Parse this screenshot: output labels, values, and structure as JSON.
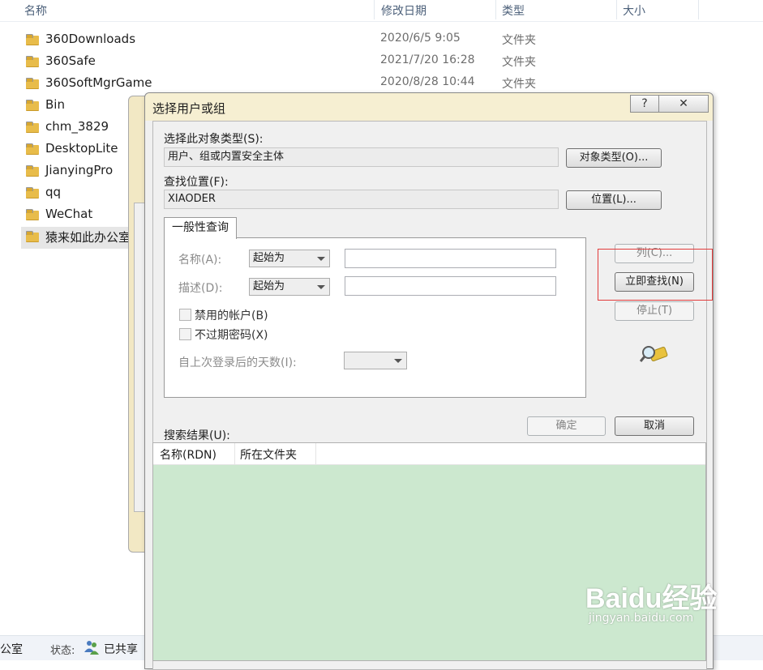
{
  "explorer": {
    "columns": {
      "name": "名称",
      "modified": "修改日期",
      "type": "类型",
      "size": "大小"
    },
    "files": [
      {
        "name": "360Downloads",
        "date": "2020/6/5 9:05",
        "type": "文件夹"
      },
      {
        "name": "360Safe",
        "date": "2021/7/20 16:28",
        "type": "文件夹"
      },
      {
        "name": "360SoftMgrGame",
        "date": "2020/8/28 10:44",
        "type": "文件夹"
      },
      {
        "name": "Bin",
        "date": "",
        "type": ""
      },
      {
        "name": "chm_3829",
        "date": "",
        "type": ""
      },
      {
        "name": "DesktopLite",
        "date": "",
        "type": ""
      },
      {
        "name": "JianyingPro",
        "date": "",
        "type": ""
      },
      {
        "name": "qq",
        "date": "",
        "type": ""
      },
      {
        "name": "WeChat",
        "date": "",
        "type": ""
      },
      {
        "name": "猿来如此办公室",
        "date": "",
        "type": ""
      }
    ],
    "status": {
      "left_text": "公室",
      "label": "状态:",
      "value": "已共享"
    }
  },
  "dialog": {
    "title": "选择用户或组",
    "help_button": "?",
    "close_button": "✕",
    "object_type_label": "选择此对象类型(S):",
    "object_type_value": "用户、组或内置安全主体",
    "object_type_button": "对象类型(O)...",
    "location_label": "查找位置(F):",
    "location_value": "XIAODER",
    "location_button": "位置(L)...",
    "tab_label": "一般性查询",
    "name_label": "名称(A):",
    "name_mode": "起始为",
    "desc_label": "描述(D):",
    "desc_mode": "起始为",
    "disabled_accounts": "禁用的帐户(B)",
    "non_expiring_pw": "不过期密码(X)",
    "days_label": "自上次登录后的天数(I):",
    "columns_button": "列(C)...",
    "find_now_button": "立即查找(N)",
    "stop_button": "停止(T)",
    "ok_button": "确定",
    "cancel_button": "取消",
    "results_label": "搜索结果(U):",
    "results_columns": {
      "name": "名称(RDN)",
      "folder": "所在文件夹"
    }
  },
  "watermark": {
    "brand": "Baidu经验",
    "url": "jingyan.baidu.com"
  }
}
